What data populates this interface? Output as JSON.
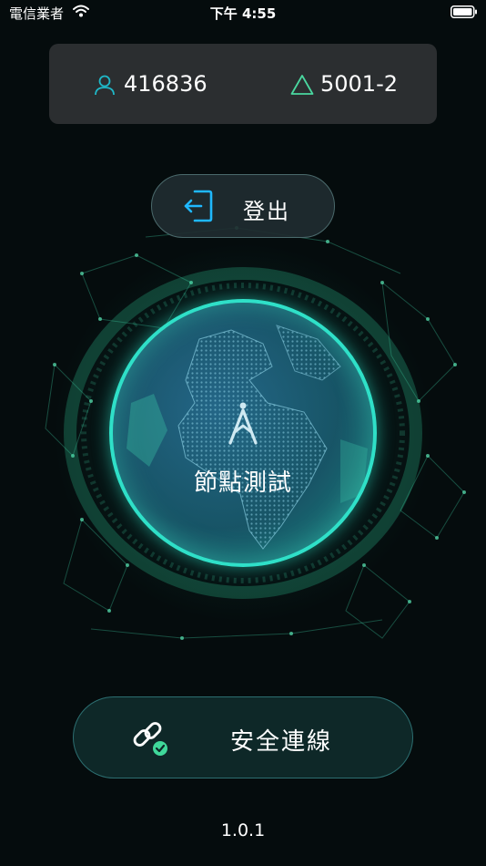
{
  "status_bar": {
    "carrier": "電信業者",
    "time": "下午 4:55"
  },
  "info_card": {
    "user_id": "416836",
    "node_id": "5001-2"
  },
  "logout": {
    "label": "登出"
  },
  "globe": {
    "label": "節點測試"
  },
  "connect": {
    "label": "安全連線"
  },
  "version": "1.0.1",
  "colors": {
    "accent": "#2fe0c8",
    "icon_blue": "#1fb8ff",
    "check_green": "#3fd89a",
    "card_bg": "#2b2e30",
    "connect_bg": "#0e2828"
  },
  "icons": {
    "user": "user-icon",
    "node": "triangle-icon",
    "logout": "logout-icon",
    "antenna": "antenna-icon",
    "link": "link-check-icon",
    "wifi": "wifi-icon",
    "battery": "battery-icon"
  }
}
